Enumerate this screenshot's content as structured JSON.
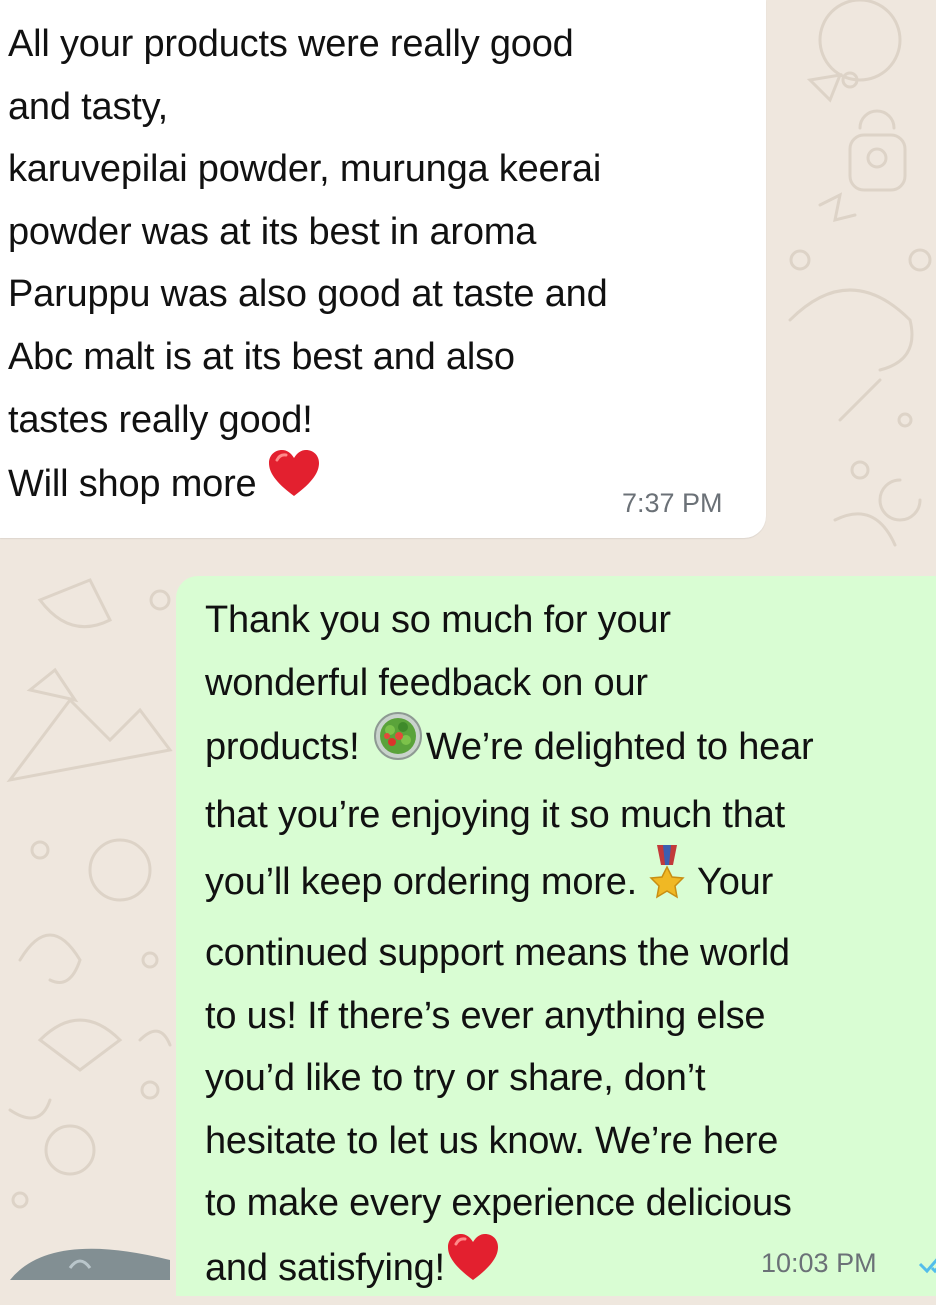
{
  "chat": {
    "incoming": {
      "lines": [
        "All your products were really good",
        "and tasty,",
        "karuvepilai powder, murunga keerai",
        "powder was at its best in aroma",
        "Paruppu was also good at taste and",
        "Abc malt is at its best and also",
        "tastes really good!",
        "Will shop more "
      ],
      "emoji": "heart-icon",
      "time": "7:37 PM"
    },
    "outgoing": {
      "lines": [
        "Thank you so much for your",
        "wonderful feedback on our",
        "products! ",
        "We’re delighted to hear",
        "that you’re enjoying it so much that",
        "you’ll keep ordering more. ",
        " Your",
        "continued support means the world",
        "to us! If there’s ever anything else",
        "you’d like to try or share, don’t",
        "hesitate to let us know. We’re here",
        "to make every experience delicious",
        "and satisfying!"
      ],
      "emojis": [
        "salad-icon",
        "medal-icon",
        "heart-icon"
      ],
      "time": "10:03 PM",
      "status": "read"
    }
  },
  "colors": {
    "wallpaper": "#efe7de",
    "incoming_bubble": "#ffffff",
    "outgoing_bubble": "#d9fdd3",
    "timestamp": "#6b7177",
    "read_ticks": "#53bdeb",
    "heart": "#e3202f"
  }
}
